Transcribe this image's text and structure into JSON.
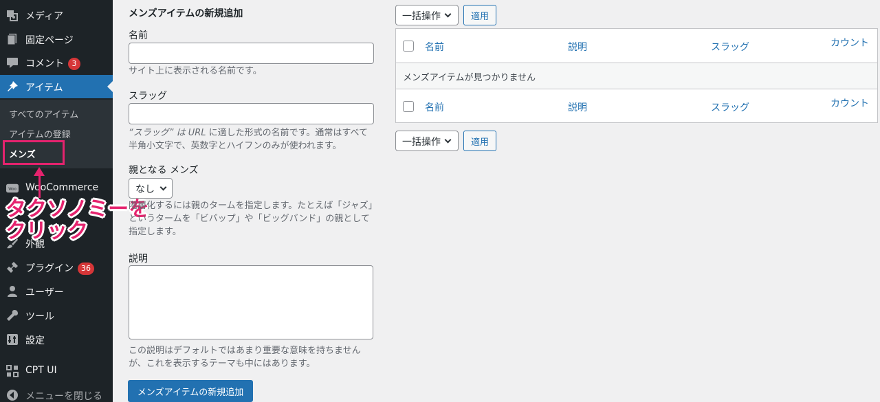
{
  "sidebar": {
    "items": [
      {
        "label": "メディア",
        "icon": "media-icon"
      },
      {
        "label": "固定ページ",
        "icon": "page-icon"
      },
      {
        "label": "コメント",
        "icon": "comment-icon",
        "badge": "3"
      },
      {
        "label": "アイテム",
        "icon": "pin-icon"
      },
      {
        "label": "WooCommerce",
        "icon": "woocommerce-icon"
      },
      {
        "label": "外観",
        "icon": "brush-icon"
      },
      {
        "label": "プラグイン",
        "icon": "plugin-icon",
        "badge": "36"
      },
      {
        "label": "ユーザー",
        "icon": "user-icon"
      },
      {
        "label": "ツール",
        "icon": "wrench-icon"
      },
      {
        "label": "設定",
        "icon": "settings-icon"
      },
      {
        "label": "CPT UI",
        "icon": "grid-icon"
      },
      {
        "label": "メニューを閉じる",
        "icon": "collapse-icon"
      }
    ],
    "submenu": [
      "すべてのアイテム",
      "アイテムの登録",
      "メンズ"
    ]
  },
  "annotation": {
    "line1": "タクソノミーを",
    "line2": "クリック",
    "color": "#e5236e"
  },
  "form": {
    "heading": "メンズアイテムの新規追加",
    "name_label": "名前",
    "name_help": "サイト上に表示される名前です。",
    "slug_label": "スラッグ",
    "slug_help_prefix": "“スラッグ” は ",
    "slug_help_url": "URL",
    "slug_help_suffix": " に適した形式の名前です。通常はすべて半角小文字で、英数字とハイフンのみが使われます。",
    "parent_label": "親となる メンズ",
    "parent_value": "なし",
    "parent_help": "階層化するには親のタームを指定します。たとえば「ジャズ」というタームを「ビバップ」や「ビッグバンド」の親として指定します。",
    "desc_label": "説明",
    "desc_help": "この説明はデフォルトではあまり重要な意味を持ちませんが、これを表示するテーマも中にはあります。",
    "submit_label": "メンズアイテムの新規追加"
  },
  "table": {
    "bulk_label": "一括操作",
    "apply_label": "適用",
    "columns": [
      "名前",
      "説明",
      "スラッグ",
      "カウント"
    ],
    "empty_message": "メンズアイテムが見つかりません"
  },
  "colors": {
    "sidebar": "#1d2327",
    "accent": "#2271b1",
    "badge": "#d63638"
  }
}
